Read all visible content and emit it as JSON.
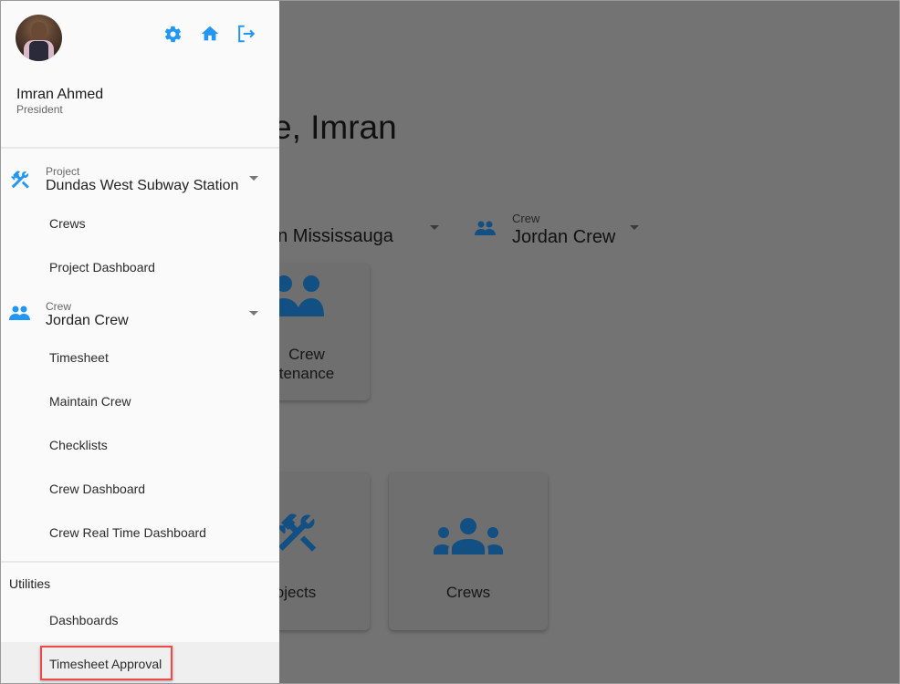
{
  "main": {
    "greeting": "e, Imran",
    "location_select": {
      "value": "tion Mississauga"
    },
    "crew_select": {
      "label": "Crew",
      "value": "Jordan Crew",
      "icon": "people-icon"
    },
    "cards": [
      {
        "line1": "Crew",
        "line2": "tenance",
        "icon": "people-icon"
      },
      {
        "label": "ojects",
        "icon": "tools-icon"
      },
      {
        "label": "Crews",
        "icon": "groups-icon"
      }
    ],
    "icon_color": "#124f82",
    "overlay_color": "#737373"
  },
  "drawer": {
    "user": {
      "name": "Imran Ahmed",
      "role": "President"
    },
    "header_icons": [
      "gear-icon",
      "home-icon",
      "logout-icon"
    ],
    "accent": "#2196f3",
    "project": {
      "label": "Project",
      "value": "Dundas West Subway Station",
      "items": [
        "Crews",
        "Project Dashboard"
      ]
    },
    "crew": {
      "label": "Crew",
      "value": "Jordan Crew",
      "items": [
        "Timesheet",
        "Maintain Crew",
        "Checklists",
        "Crew Dashboard",
        "Crew Real Time Dashboard"
      ]
    },
    "utilities": {
      "title": "Utilities",
      "items": [
        "Dashboards",
        "Timesheet Approval"
      ]
    },
    "highlight_color": "#f04848"
  }
}
